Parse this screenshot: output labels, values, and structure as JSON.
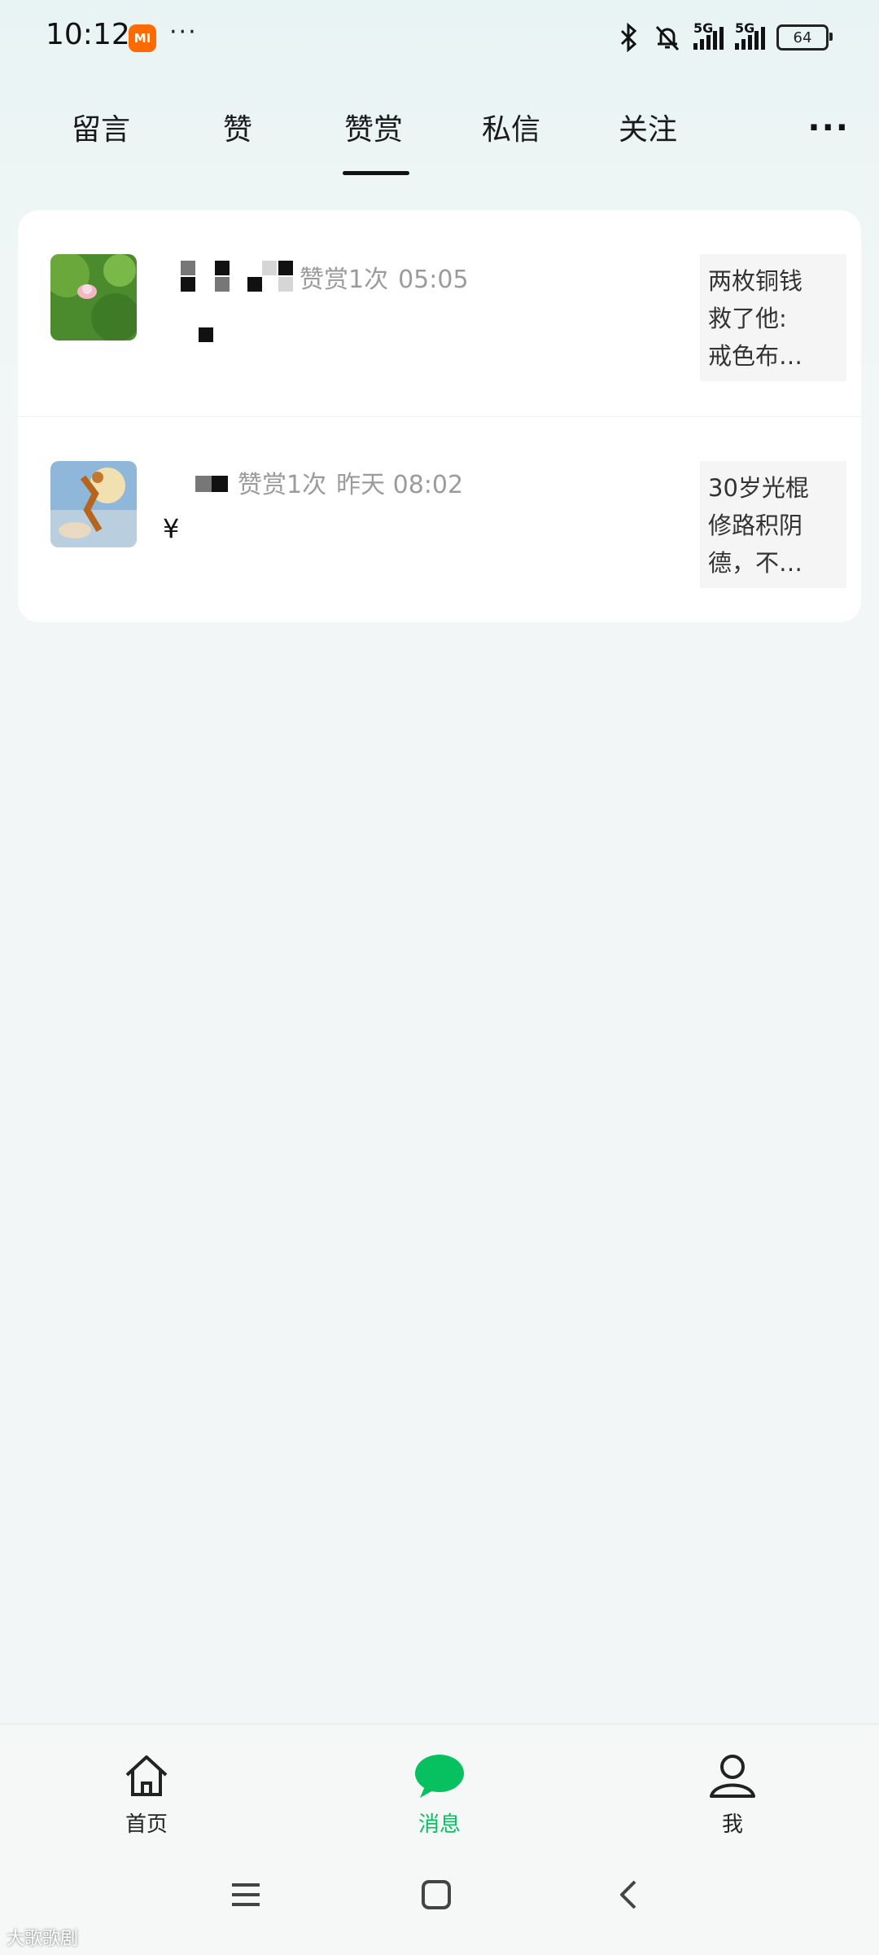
{
  "status_bar": {
    "time": "10:12",
    "mi_label": "MI",
    "dots": "···",
    "net1": "5G",
    "net2": "5G",
    "battery": "64"
  },
  "tabs": {
    "items": [
      {
        "label": "留言"
      },
      {
        "label": "赞"
      },
      {
        "label": "赞赏"
      },
      {
        "label": "私信"
      },
      {
        "label": "关注"
      }
    ],
    "active": "赞赏",
    "more": "···"
  },
  "notifications": [
    {
      "action": "赞赏1次",
      "time": "05:05",
      "currency": "",
      "preview": [
        "两枚铜钱",
        "救了他:",
        "戒色布…"
      ]
    },
    {
      "action": "赞赏1次",
      "time": "昨天 08:02",
      "currency": "¥",
      "preview": [
        "30岁光棍",
        "修路积阴",
        "德，不…"
      ]
    }
  ],
  "bottom_nav": {
    "items": [
      {
        "label": "首页",
        "icon": "home-icon"
      },
      {
        "label": "消息",
        "icon": "chat-bubble-icon",
        "active": true
      },
      {
        "label": "我",
        "icon": "person-icon"
      }
    ]
  },
  "watermark": "大歌歌剧",
  "colors": {
    "accent": "#07c160",
    "background": "#f3f6f6",
    "meta_text": "#9b9b9b"
  }
}
